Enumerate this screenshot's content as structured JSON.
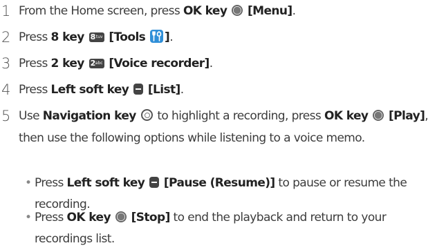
{
  "steps": [
    {
      "number": "1",
      "pre": "From the Home screen, press ",
      "key": "OK key",
      "bracket": "[Menu]",
      "post": "."
    },
    {
      "number": "2",
      "pre": "Press ",
      "key": "8 key",
      "key_digit": "8",
      "key_letters": "tuv",
      "bracket": "[Tools",
      "bracket_end": "]",
      "post": "."
    },
    {
      "number": "3",
      "pre": "Press ",
      "key": "2 key",
      "key_digit": "2",
      "key_letters": "abc",
      "bracket": "[Voice recorder]",
      "post": "."
    },
    {
      "number": "4",
      "pre": "Press ",
      "key": "Left soft key",
      "bracket": "[List]",
      "post": "."
    },
    {
      "number": "5",
      "pre": "Use ",
      "key": "Navigation key",
      "mid": " to highlight a recording, press ",
      "key2": "OK key",
      "bracket": "[Play]",
      "post": ", then use the following options while listening to a voice memo."
    }
  ],
  "bullets": [
    {
      "pre": "Press ",
      "key": "Left soft key",
      "bracket": "[Pause (Resume)]",
      "post": " to pause or resume the recording."
    },
    {
      "pre": "Press ",
      "key": "OK key",
      "bracket": "[Stop]",
      "post": " to end the playback and return to your recordings list."
    }
  ],
  "bullet_glyph": "•",
  "icons": {
    "ok": "ok-key-icon",
    "nav": "navigation-key-icon",
    "soft": "left-soft-key-icon",
    "numkey": "number-key-icon",
    "tools": "tools-app-icon",
    "tools_color": "#2f8fd8"
  }
}
